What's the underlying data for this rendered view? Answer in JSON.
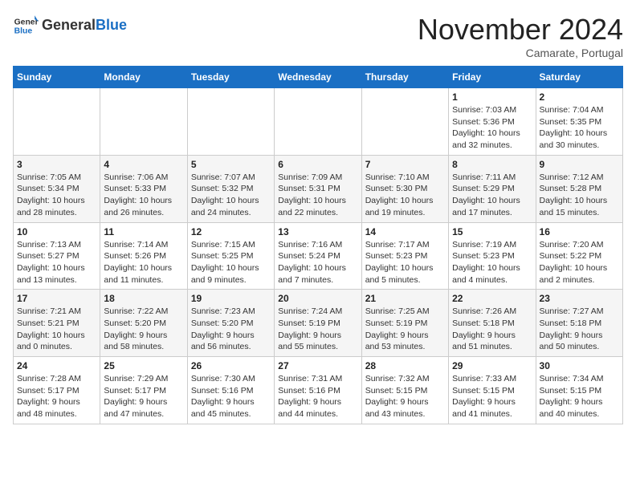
{
  "header": {
    "logo_general": "General",
    "logo_blue": "Blue",
    "month_title": "November 2024",
    "location": "Camarate, Portugal"
  },
  "weekdays": [
    "Sunday",
    "Monday",
    "Tuesday",
    "Wednesday",
    "Thursday",
    "Friday",
    "Saturday"
  ],
  "weeks": [
    [
      {
        "day": "",
        "info": ""
      },
      {
        "day": "",
        "info": ""
      },
      {
        "day": "",
        "info": ""
      },
      {
        "day": "",
        "info": ""
      },
      {
        "day": "",
        "info": ""
      },
      {
        "day": "1",
        "info": "Sunrise: 7:03 AM\nSunset: 5:36 PM\nDaylight: 10 hours\nand 32 minutes."
      },
      {
        "day": "2",
        "info": "Sunrise: 7:04 AM\nSunset: 5:35 PM\nDaylight: 10 hours\nand 30 minutes."
      }
    ],
    [
      {
        "day": "3",
        "info": "Sunrise: 7:05 AM\nSunset: 5:34 PM\nDaylight: 10 hours\nand 28 minutes."
      },
      {
        "day": "4",
        "info": "Sunrise: 7:06 AM\nSunset: 5:33 PM\nDaylight: 10 hours\nand 26 minutes."
      },
      {
        "day": "5",
        "info": "Sunrise: 7:07 AM\nSunset: 5:32 PM\nDaylight: 10 hours\nand 24 minutes."
      },
      {
        "day": "6",
        "info": "Sunrise: 7:09 AM\nSunset: 5:31 PM\nDaylight: 10 hours\nand 22 minutes."
      },
      {
        "day": "7",
        "info": "Sunrise: 7:10 AM\nSunset: 5:30 PM\nDaylight: 10 hours\nand 19 minutes."
      },
      {
        "day": "8",
        "info": "Sunrise: 7:11 AM\nSunset: 5:29 PM\nDaylight: 10 hours\nand 17 minutes."
      },
      {
        "day": "9",
        "info": "Sunrise: 7:12 AM\nSunset: 5:28 PM\nDaylight: 10 hours\nand 15 minutes."
      }
    ],
    [
      {
        "day": "10",
        "info": "Sunrise: 7:13 AM\nSunset: 5:27 PM\nDaylight: 10 hours\nand 13 minutes."
      },
      {
        "day": "11",
        "info": "Sunrise: 7:14 AM\nSunset: 5:26 PM\nDaylight: 10 hours\nand 11 minutes."
      },
      {
        "day": "12",
        "info": "Sunrise: 7:15 AM\nSunset: 5:25 PM\nDaylight: 10 hours\nand 9 minutes."
      },
      {
        "day": "13",
        "info": "Sunrise: 7:16 AM\nSunset: 5:24 PM\nDaylight: 10 hours\nand 7 minutes."
      },
      {
        "day": "14",
        "info": "Sunrise: 7:17 AM\nSunset: 5:23 PM\nDaylight: 10 hours\nand 5 minutes."
      },
      {
        "day": "15",
        "info": "Sunrise: 7:19 AM\nSunset: 5:23 PM\nDaylight: 10 hours\nand 4 minutes."
      },
      {
        "day": "16",
        "info": "Sunrise: 7:20 AM\nSunset: 5:22 PM\nDaylight: 10 hours\nand 2 minutes."
      }
    ],
    [
      {
        "day": "17",
        "info": "Sunrise: 7:21 AM\nSunset: 5:21 PM\nDaylight: 10 hours\nand 0 minutes."
      },
      {
        "day": "18",
        "info": "Sunrise: 7:22 AM\nSunset: 5:20 PM\nDaylight: 9 hours\nand 58 minutes."
      },
      {
        "day": "19",
        "info": "Sunrise: 7:23 AM\nSunset: 5:20 PM\nDaylight: 9 hours\nand 56 minutes."
      },
      {
        "day": "20",
        "info": "Sunrise: 7:24 AM\nSunset: 5:19 PM\nDaylight: 9 hours\nand 55 minutes."
      },
      {
        "day": "21",
        "info": "Sunrise: 7:25 AM\nSunset: 5:19 PM\nDaylight: 9 hours\nand 53 minutes."
      },
      {
        "day": "22",
        "info": "Sunrise: 7:26 AM\nSunset: 5:18 PM\nDaylight: 9 hours\nand 51 minutes."
      },
      {
        "day": "23",
        "info": "Sunrise: 7:27 AM\nSunset: 5:18 PM\nDaylight: 9 hours\nand 50 minutes."
      }
    ],
    [
      {
        "day": "24",
        "info": "Sunrise: 7:28 AM\nSunset: 5:17 PM\nDaylight: 9 hours\nand 48 minutes."
      },
      {
        "day": "25",
        "info": "Sunrise: 7:29 AM\nSunset: 5:17 PM\nDaylight: 9 hours\nand 47 minutes."
      },
      {
        "day": "26",
        "info": "Sunrise: 7:30 AM\nSunset: 5:16 PM\nDaylight: 9 hours\nand 45 minutes."
      },
      {
        "day": "27",
        "info": "Sunrise: 7:31 AM\nSunset: 5:16 PM\nDaylight: 9 hours\nand 44 minutes."
      },
      {
        "day": "28",
        "info": "Sunrise: 7:32 AM\nSunset: 5:15 PM\nDaylight: 9 hours\nand 43 minutes."
      },
      {
        "day": "29",
        "info": "Sunrise: 7:33 AM\nSunset: 5:15 PM\nDaylight: 9 hours\nand 41 minutes."
      },
      {
        "day": "30",
        "info": "Sunrise: 7:34 AM\nSunset: 5:15 PM\nDaylight: 9 hours\nand 40 minutes."
      }
    ]
  ]
}
